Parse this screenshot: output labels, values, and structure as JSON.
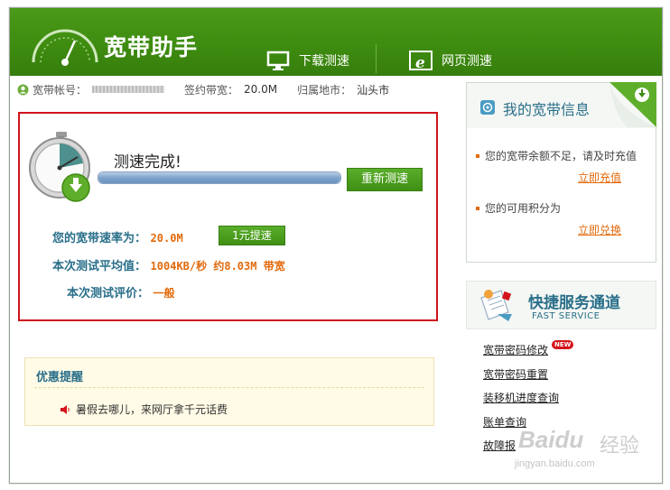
{
  "app": {
    "title": "宽带助手"
  },
  "tabs": [
    {
      "label": "下载测速"
    },
    {
      "label": "网页测速"
    }
  ],
  "account": {
    "account_label": "宽带帐号：",
    "bandwidth_label": "签约带宽：",
    "bandwidth_value": "20.0M",
    "region_label": "归属地市：",
    "region_value": "汕头市"
  },
  "result": {
    "status": "测速完成!",
    "progress_percent": 100,
    "retest_button": "重新测速",
    "rate_label": "您的宽带速率为：",
    "rate_value": "20.0M",
    "boost_button": "1元提速",
    "avg_label": "本次测试平均值：",
    "avg_value": "1004KB/秒 约8.03M 带宽",
    "eval_label": "本次测试评价：",
    "eval_value": "一般"
  },
  "promo": {
    "title": "优惠提醒",
    "item": "暑假去哪儿，来网厅拿千元话费"
  },
  "my_info": {
    "title": "我的宽带信息",
    "balance_text": "您的宽带余额不足，请及时充值",
    "recharge_link": "立即充值",
    "points_text": "您的可用积分为",
    "redeem_link": "立即兑换"
  },
  "fast_service": {
    "title": "快捷服务通道",
    "subtitle": "FAST SERVICE",
    "links": [
      "宽带密码修改",
      "宽带密码重置",
      "装移机进度查询",
      "账单查询",
      "故障报"
    ],
    "new_badge": "NEW"
  },
  "watermark": {
    "brand": "Baidu",
    "cn": "经验",
    "url": "jingyan.baidu.com"
  },
  "colors": {
    "header_green": "#3e8c10",
    "accent_orange": "#e26a0c",
    "label_teal": "#2a6f8a",
    "highlight_red": "#d0131b"
  }
}
